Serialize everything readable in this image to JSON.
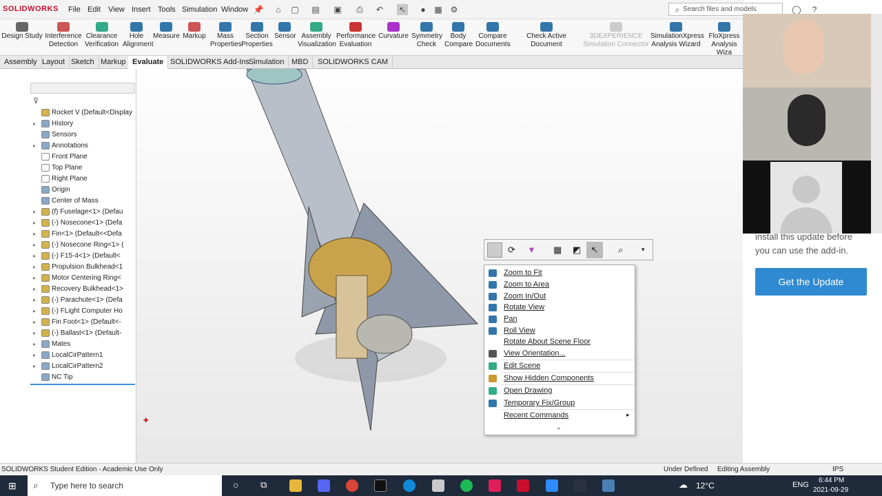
{
  "app": {
    "logo": "SOLIDWORKS"
  },
  "menu": [
    "File",
    "Edit",
    "View",
    "Insert",
    "Tools",
    "Simulation",
    "Window"
  ],
  "search": {
    "placeholder": "Search files and models"
  },
  "commands": [
    {
      "label1": "Design Study",
      "label2": ""
    },
    {
      "label1": "Interference",
      "label2": "Detection"
    },
    {
      "label1": "Clearance",
      "label2": "Verification"
    },
    {
      "label1": "Hole",
      "label2": "Alignment"
    },
    {
      "label1": "Measure",
      "label2": ""
    },
    {
      "label1": "Markup",
      "label2": ""
    },
    {
      "label1": "Mass",
      "label2": "Properties"
    },
    {
      "label1": "Section",
      "label2": "Properties"
    },
    {
      "label1": "Sensor",
      "label2": ""
    },
    {
      "label1": "Assembly",
      "label2": "Visualization"
    },
    {
      "label1": "Performance",
      "label2": "Evaluation"
    },
    {
      "label1": "Curvature",
      "label2": ""
    },
    {
      "label1": "Symmetry",
      "label2": "Check"
    },
    {
      "label1": "Body",
      "label2": "Compare"
    },
    {
      "label1": "Compare",
      "label2": "Documents"
    },
    {
      "label1": "Check Active Document",
      "label2": ""
    },
    {
      "label1": "3DEXPERIENCE",
      "label2": "Simulation Connector"
    },
    {
      "label1": "SimulationXpress",
      "label2": "Analysis Wizard"
    },
    {
      "label1": "FloXpress",
      "label2": "Analysis Wiza"
    }
  ],
  "tabs": [
    "Assembly",
    "Layout",
    "Sketch",
    "Markup",
    "Evaluate",
    "SOLIDWORKS Add-Ins",
    "Simulation",
    "MBD",
    "SOLIDWORKS CAM"
  ],
  "tree": [
    "Rocket V  (Default<Display",
    "History",
    "Sensors",
    "Annotations",
    "Front Plane",
    "Top Plane",
    "Right Plane",
    "Origin",
    "Center of Mass",
    "(f) Fuselage<1> (Defau",
    "(-) Nosecone<1> (Defa",
    "Fin<1> (Default<<Defa",
    "(-) Nosecone Ring<1> (",
    "(-) F15-4<1> (Default<",
    "Propulsion Bulkhead<1",
    "Motor Centering Ring<",
    "Recovery Bulkhead<1>",
    "(-) Parachute<1> (Defa",
    "(-) FLight Computer Ho",
    "Fin Foot<1> (Default<-",
    "(-) Ballast<1> (Default-",
    "Mates",
    "LocalCirPattern1",
    "LocalCirPattern2",
    "NC Tip"
  ],
  "context_menu": [
    "Zoom to Fit",
    "Zoom to Area",
    "Zoom In/Out",
    "Rotate View",
    "Pan",
    "Roll View",
    "Rotate About Scene Floor",
    "View Orientation...",
    "Edit Scene",
    "Show Hidden Components",
    "Open Drawing",
    "Temporary Fix/Group",
    "Recent Commands"
  ],
  "right_panel": {
    "text1": "install this update before",
    "text2": "you can use the add-in.",
    "button": "Get the Update"
  },
  "status": {
    "left": "SOLIDWORKS Student Edition - Academic Use Only",
    "underdefined": "Under Defined",
    "editing": "Editing Assembly",
    "units": "IPS"
  },
  "taskbar": {
    "search": "Type here to search",
    "temp": "12°C",
    "lang": "ENG",
    "time": "6:44 PM",
    "date": "2021-09-29"
  }
}
